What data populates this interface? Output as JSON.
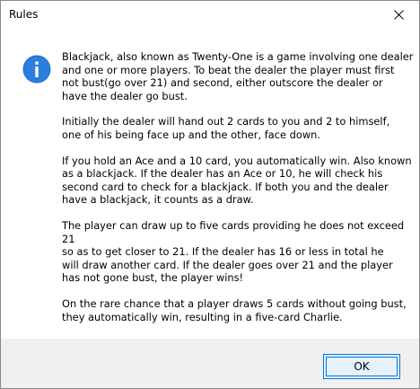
{
  "window": {
    "title": "Rules",
    "close_icon": "close-icon"
  },
  "message": {
    "icon": "info-icon",
    "paragraphs": [
      "Blackjack, also known as Twenty-One is a game involving one dealer\nand one or more players. To beat the dealer the player must first\nnot bust(go over 21) and second, either outscore the dealer or\nhave the dealer go bust.",
      "Initially the dealer will hand out 2 cards to you and 2 to himself,\none of his being face up and the other, face down.",
      "If you hold an Ace and a 10 card, you automatically win. Also known\nas a blackjack. If the dealer has an Ace or 10, he will check his\nsecond card to check for a blackjack. If both you and the dealer\nhave a blackjack, it counts as a draw.",
      "The player can draw up to five cards providing he does not exceed 21\nso as to get closer to 21. If the dealer has 16 or less in total he\nwill draw another card. If the dealer goes over 21 and the player\nhas not gone bust, the player wins!",
      "On the rare chance that a player draws 5 cards without going bust,\nthey automatically win, resulting in a five-card Charlie."
    ]
  },
  "footer": {
    "ok_label": "OK"
  },
  "colors": {
    "accent": "#0078d7",
    "footer_bg": "#f0f0f0"
  }
}
